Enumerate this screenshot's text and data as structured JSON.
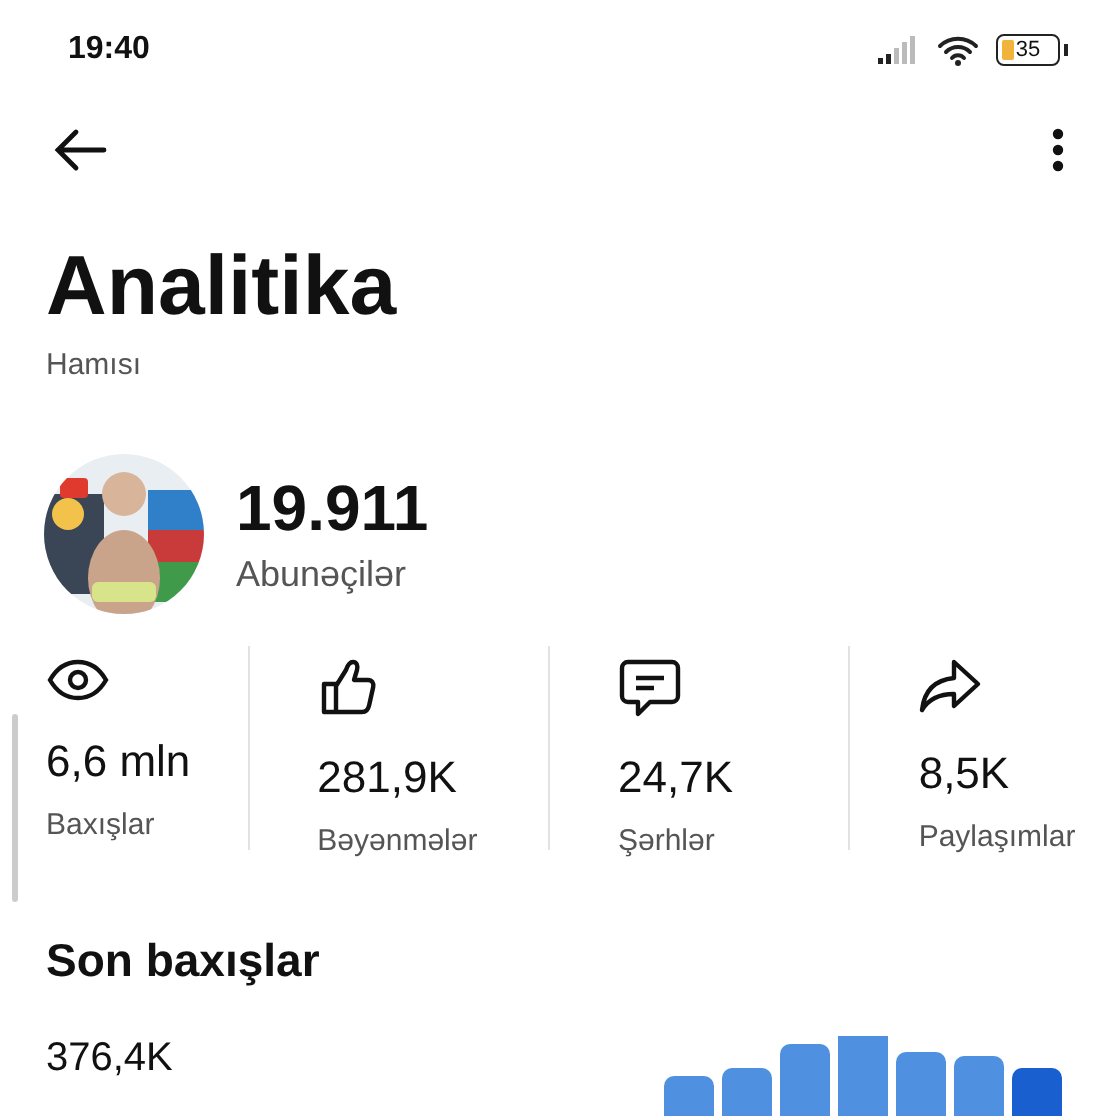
{
  "status_bar": {
    "time": "19:40",
    "battery": "35"
  },
  "title": "Analitika",
  "subtitle": "Hamısı",
  "channel": {
    "count": "19.911",
    "label": "Abunəçilər"
  },
  "stats": [
    {
      "kind": "views",
      "value": "6,6 mln",
      "label": "Baxışlar"
    },
    {
      "kind": "likes",
      "value": "281,9K",
      "label": "Bəyənmələr"
    },
    {
      "kind": "comments",
      "value": "24,7K",
      "label": "Şərhlər"
    },
    {
      "kind": "shares",
      "value": "8,5K",
      "label": "Paylaşımlar"
    }
  ],
  "recent": {
    "heading": "Son baxışlar",
    "value": "376,4K"
  }
}
